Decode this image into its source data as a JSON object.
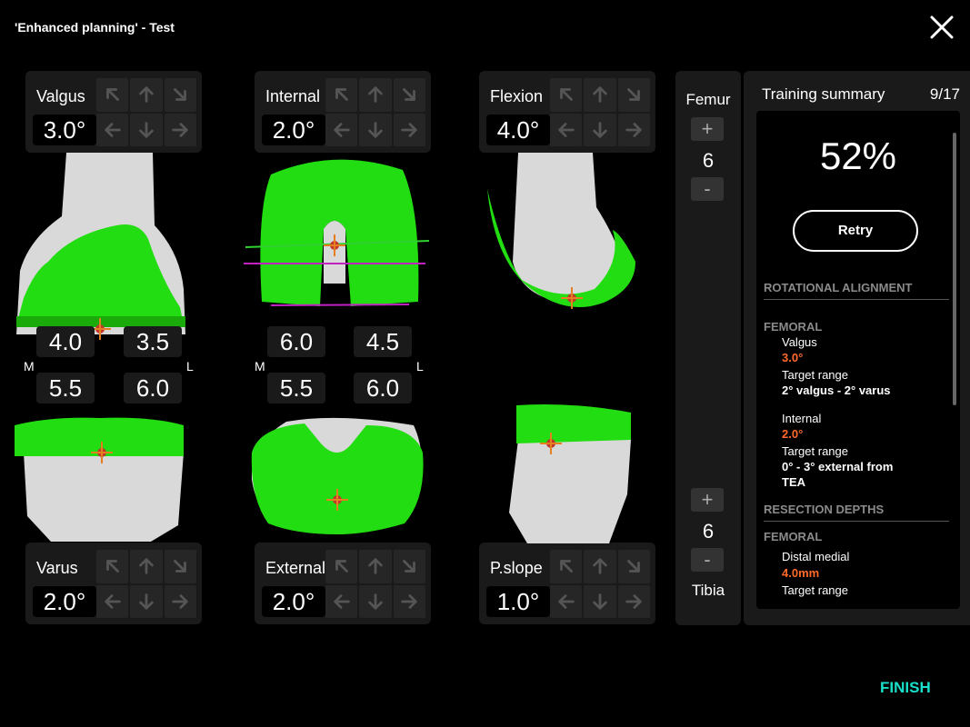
{
  "title": "'Enhanced planning' - Test",
  "controls": {
    "valgus": {
      "label": "Valgus",
      "value": "3.0°"
    },
    "internal": {
      "label": "Internal",
      "value": "2.0°"
    },
    "flexion": {
      "label": "Flexion",
      "value": "4.0°"
    },
    "varus": {
      "label": "Varus",
      "value": "2.0°"
    },
    "external": {
      "label": "External",
      "value": "2.0°"
    },
    "pslope": {
      "label": "P.slope",
      "value": "1.0°"
    }
  },
  "depths": {
    "left": [
      "4.0",
      "3.5",
      "5.5",
      "6.0"
    ],
    "mid": [
      "6.0",
      "4.5",
      "5.5",
      "6.0"
    ],
    "m_label": "M",
    "l_label": "L"
  },
  "sidebar": {
    "femur_label": "Femur",
    "femur_value": "6",
    "tibia_label": "Tibia",
    "tibia_value": "6",
    "plus": "+",
    "minus": "-"
  },
  "summary": {
    "header": "Training summary",
    "page": "9/17",
    "score": "52%",
    "retry": "Retry",
    "section_rotational": "ROTATIONAL ALIGNMENT",
    "femoral_label": "FEMORAL",
    "valgus_label": "Valgus",
    "valgus_value": "3.0°",
    "target_range_label": "Target range",
    "valgus_range": "2° valgus - 2° varus",
    "internal_label": "Internal",
    "internal_value": "2.0°",
    "internal_range_1": "0° - 3° external from",
    "internal_range_2": "TEA",
    "section_resection": "RESECTION DEPTHS",
    "femoral_label_2": "FEMORAL",
    "distal_medial_label": "Distal medial",
    "distal_medial_value": "4.0mm",
    "target_range_label_2": "Target range"
  },
  "finish": "FINISH",
  "colors": {
    "accent": "#19e0c8",
    "highlight": "#ff6a2b",
    "implant": "#22dd11"
  }
}
